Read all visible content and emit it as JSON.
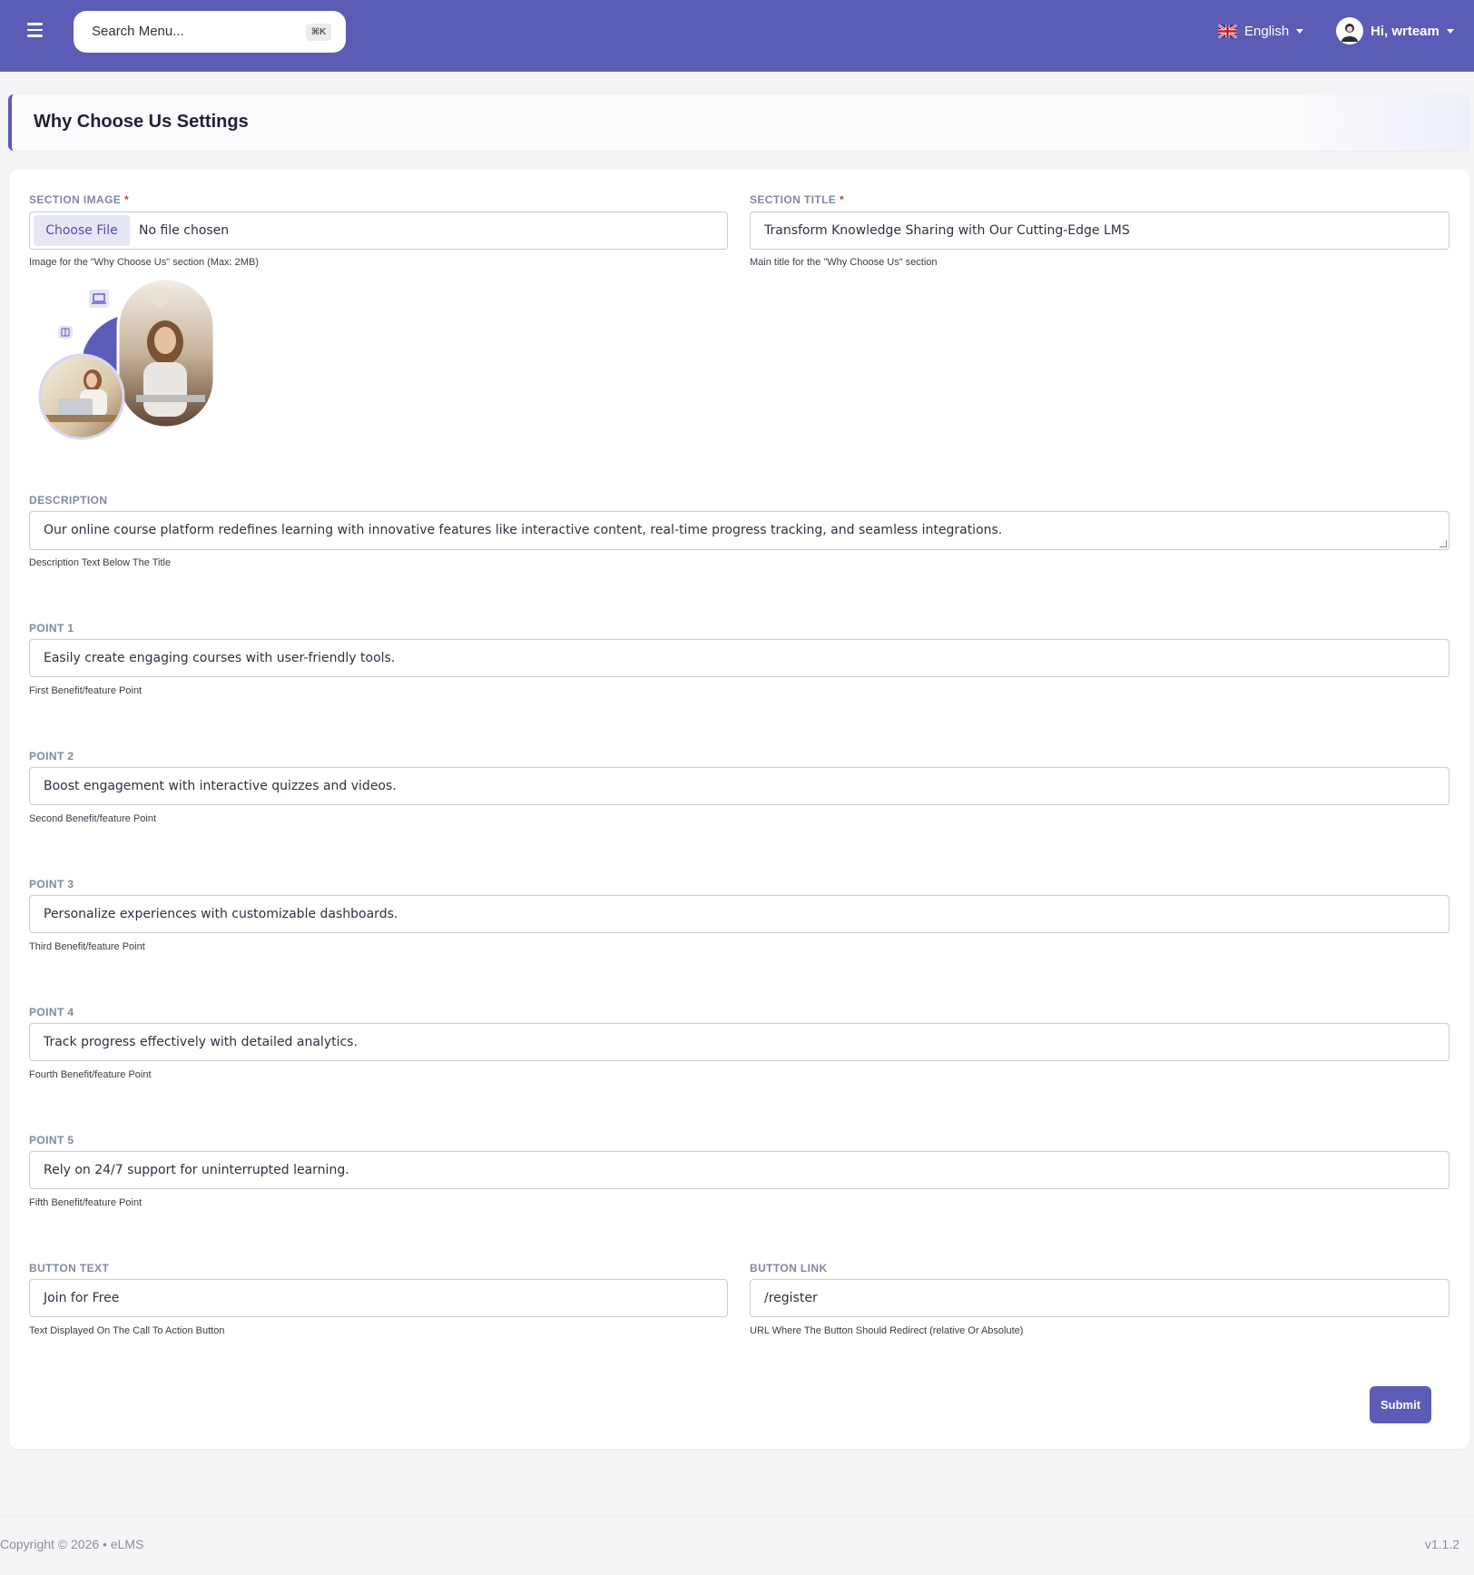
{
  "navbar": {
    "search_placeholder": "Search Menu...",
    "search_shortcut": "⌘K",
    "language": "English",
    "user_greeting": "Hi, wrteam"
  },
  "page": {
    "title": "Why Choose Us Settings"
  },
  "form": {
    "section_image": {
      "label": "SECTION IMAGE",
      "required_mark": "*",
      "choose_label": "Choose File",
      "status": "No file chosen",
      "help": "Image for the \"Why Choose Us\" section (Max: 2MB)"
    },
    "section_title": {
      "label": "SECTION TITLE",
      "required_mark": "*",
      "value": "Transform Knowledge Sharing with Our Cutting-Edge LMS",
      "help": "Main title for the \"Why Choose Us\" section"
    },
    "description": {
      "label": "DESCRIPTION",
      "value": "Our online course platform redefines learning with innovative features like interactive content, real-time progress tracking, and seamless integrations.",
      "help": "Description Text Below The Title"
    },
    "points": [
      {
        "label": "POINT 1",
        "value": "Easily create engaging courses with user-friendly tools.",
        "help": "First Benefit/feature Point"
      },
      {
        "label": "POINT 2",
        "value": "Boost engagement with interactive quizzes and videos.",
        "help": "Second Benefit/feature Point"
      },
      {
        "label": "POINT 3",
        "value": "Personalize experiences with customizable dashboards.",
        "help": "Third Benefit/feature Point"
      },
      {
        "label": "POINT 4",
        "value": "Track progress effectively with detailed analytics.",
        "help": "Fourth Benefit/feature Point"
      },
      {
        "label": "POINT 5",
        "value": "Rely on 24/7 support for uninterrupted learning.",
        "help": "Fifth Benefit/feature Point"
      }
    ],
    "button_text": {
      "label": "BUTTON TEXT",
      "value": "Join for Free",
      "help": "Text Displayed On The Call To Action Button"
    },
    "button_link": {
      "label": "BUTTON LINK",
      "value": "/register",
      "help": "URL Where The Button Should Redirect (relative Or Absolute)"
    },
    "submit_label": "Submit"
  },
  "footer": {
    "copyright": "Copyright © 2026  •  eLMS",
    "version": "v1.1.2"
  },
  "colors": {
    "accent": "#5a5cb5",
    "required": "#e0314f",
    "background": "#f5f5f7"
  },
  "icons": {
    "menu": "hamburger-icon",
    "flag": "uk-flag-icon",
    "avatar": "user-avatar-icon",
    "laptop": "laptop-icon",
    "book": "book-icon"
  }
}
